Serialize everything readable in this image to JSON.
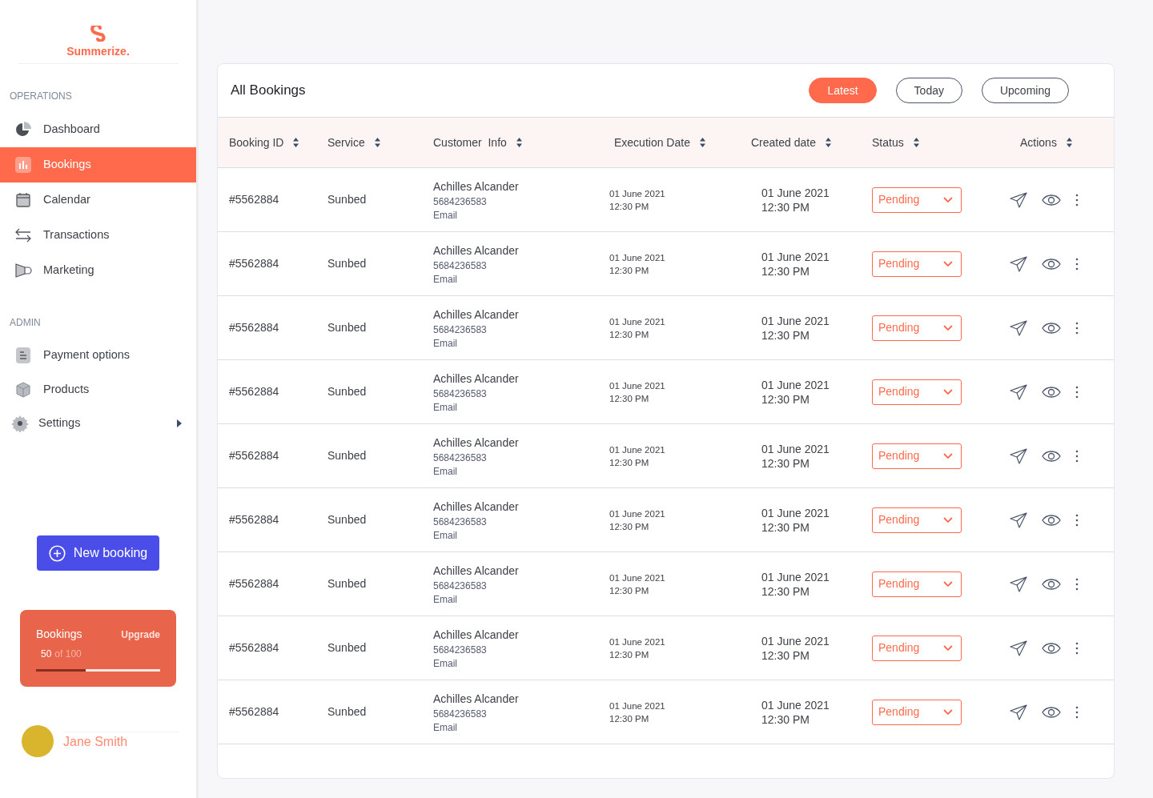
{
  "brand": {
    "name": "Summerize."
  },
  "sidebar": {
    "sections": [
      {
        "title": "OPERATIONS",
        "items": [
          {
            "label": "Dashboard",
            "kind": "pie",
            "selected": false
          },
          {
            "label": "Bookings",
            "kind": "bars",
            "selected": true
          },
          {
            "label": "Calendar",
            "kind": "calendar",
            "selected": false
          },
          {
            "label": "Transactions",
            "kind": "arrows",
            "selected": false
          },
          {
            "label": "Marketing",
            "kind": "megaphone",
            "selected": false
          }
        ]
      },
      {
        "title": "ADMIN",
        "items": [
          {
            "label": "Payment options",
            "kind": "list",
            "selected": false
          },
          {
            "label": "Products",
            "kind": "box",
            "selected": false
          },
          {
            "label": "Settings",
            "kind": "gear",
            "selected": false,
            "submenu": true
          }
        ]
      }
    ]
  },
  "new_booking_button": {
    "label": "New booking"
  },
  "usage_card": {
    "title": "Bookings",
    "action": "Upgrade",
    "used": "50",
    "total": "of 100",
    "level": 0.4
  },
  "user": {
    "name": "Jane Smith"
  },
  "bookings": {
    "title": "All Bookings",
    "filters": [
      {
        "label": "Latest",
        "selected": true
      },
      {
        "label": "Today",
        "selected": false
      },
      {
        "label": "Upcoming",
        "selected": false
      }
    ],
    "columns": [
      "Booking ID",
      "Service",
      "Customer  Info",
      "Execution Date",
      "Created date",
      "Status",
      "Actions"
    ],
    "rows": [
      {
        "id": "#5562884",
        "service": "Sunbed",
        "customer": "Achilles Alcander",
        "phone": "5684236583",
        "email": "Email",
        "execution_date": "01 June 2021",
        "execution_time": "12:30 PM",
        "created_date": "01 June 2021",
        "created_time": "12:30 PM",
        "status": "Pending"
      },
      {
        "id": "#5562884",
        "service": "Sunbed",
        "customer": "Achilles Alcander",
        "phone": "5684236583",
        "email": "Email",
        "execution_date": "01 June 2021",
        "execution_time": "12:30 PM",
        "created_date": "01 June 2021",
        "created_time": "12:30 PM",
        "status": "Pending"
      },
      {
        "id": "#5562884",
        "service": "Sunbed",
        "customer": "Achilles Alcander",
        "phone": "5684236583",
        "email": "Email",
        "execution_date": "01 June 2021",
        "execution_time": "12:30 PM",
        "created_date": "01 June 2021",
        "created_time": "12:30 PM",
        "status": "Pending"
      },
      {
        "id": "#5562884",
        "service": "Sunbed",
        "customer": "Achilles Alcander",
        "phone": "5684236583",
        "email": "Email",
        "execution_date": "01 June 2021",
        "execution_time": "12:30 PM",
        "created_date": "01 June 2021",
        "created_time": "12:30 PM",
        "status": "Pending"
      },
      {
        "id": "#5562884",
        "service": "Sunbed",
        "customer": "Achilles Alcander",
        "phone": "5684236583",
        "email": "Email",
        "execution_date": "01 June 2021",
        "execution_time": "12:30 PM",
        "created_date": "01 June 2021",
        "created_time": "12:30 PM",
        "status": "Pending"
      },
      {
        "id": "#5562884",
        "service": "Sunbed",
        "customer": "Achilles Alcander",
        "phone": "5684236583",
        "email": "Email",
        "execution_date": "01 June 2021",
        "execution_time": "12:30 PM",
        "created_date": "01 June 2021",
        "created_time": "12:30 PM",
        "status": "Pending"
      },
      {
        "id": "#5562884",
        "service": "Sunbed",
        "customer": "Achilles Alcander",
        "phone": "5684236583",
        "email": "Email",
        "execution_date": "01 June 2021",
        "execution_time": "12:30 PM",
        "created_date": "01 June 2021",
        "created_time": "12:30 PM",
        "status": "Pending"
      },
      {
        "id": "#5562884",
        "service": "Sunbed",
        "customer": "Achilles Alcander",
        "phone": "5684236583",
        "email": "Email",
        "execution_date": "01 June 2021",
        "execution_time": "12:30 PM",
        "created_date": "01 June 2021",
        "created_time": "12:30 PM",
        "status": "Pending"
      },
      {
        "id": "#5562884",
        "service": "Sunbed",
        "customer": "Achilles Alcander",
        "phone": "5684236583",
        "email": "Email",
        "execution_date": "01 June 2021",
        "execution_time": "12:30 PM",
        "created_date": "01 June 2021",
        "created_time": "12:30 PM",
        "status": "Pending"
      }
    ]
  }
}
